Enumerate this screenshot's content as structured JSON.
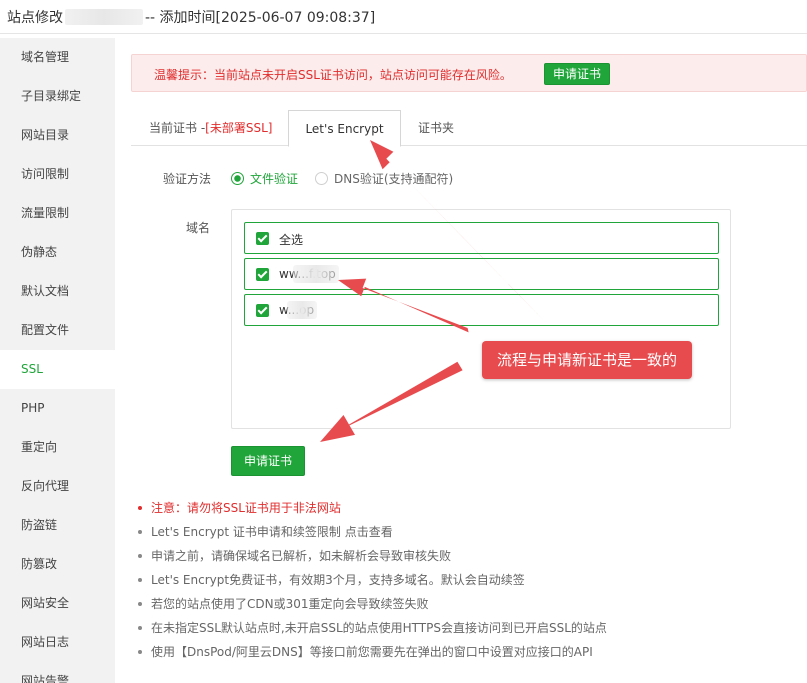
{
  "window": {
    "title_prefix": "站点修改",
    "title_suffix": "-- 添加时间[2025-06-07 09:08:37]"
  },
  "sidebar": {
    "items": [
      {
        "label": "域名管理"
      },
      {
        "label": "子目录绑定"
      },
      {
        "label": "网站目录"
      },
      {
        "label": "访问限制"
      },
      {
        "label": "流量限制"
      },
      {
        "label": "伪静态"
      },
      {
        "label": "默认文档"
      },
      {
        "label": "配置文件"
      },
      {
        "label": "SSL",
        "active": true
      },
      {
        "label": "PHP"
      },
      {
        "label": "重定向"
      },
      {
        "label": "反向代理"
      },
      {
        "label": "防盗链"
      },
      {
        "label": "防篡改"
      },
      {
        "label": "网站安全"
      },
      {
        "label": "网站日志"
      },
      {
        "label": "网站告警"
      }
    ]
  },
  "alert": {
    "text": "温馨提示：当前站点未开启SSL证书访问，站点访问可能存在风险。",
    "button": "申请证书"
  },
  "tabs": {
    "current_cert": "当前证书 -",
    "current_cert_status": "[未部署SSL]",
    "letsencrypt": "Let's Encrypt",
    "cert_folder": "证书夹"
  },
  "form": {
    "verify_label": "验证方法",
    "verify_options": {
      "file": "文件验证",
      "dns": "DNS验证(支持通配符)"
    },
    "selected_verify": "file",
    "domain_label": "域名",
    "domains": [
      {
        "label": "全选",
        "checked": true
      },
      {
        "label": "ww...f.top",
        "checked": true
      },
      {
        "label": "w...op",
        "checked": true
      }
    ],
    "apply_button": "申请证书"
  },
  "notes": [
    {
      "text": "注意：请勿将SSL证书用于非法网站",
      "warn": true
    },
    {
      "text": "Let's Encrypt 证书申请和续签限制 点击查看",
      "warn": false
    },
    {
      "text": "申请之前，请确保域名已解析，如未解析会导致审核失败",
      "warn": false
    },
    {
      "text": "Let's Encrypt免费证书，有效期3个月，支持多域名。默认会自动续签",
      "warn": false
    },
    {
      "text": "若您的站点使用了CDN或301重定向会导致续签失败",
      "warn": false
    },
    {
      "text": "在未指定SSL默认站点时,未开启SSL的站点使用HTTPS会直接访问到已开启SSL的站点",
      "warn": false
    },
    {
      "text": "使用【DnsPod/阿里云DNS】等接口前您需要先在弹出的窗口中设置对应接口的API",
      "warn": false
    }
  ],
  "annotation": {
    "callout_text": "流程与申请新证书是一致的"
  },
  "colors": {
    "brand_green": "#20a53a",
    "alert_red": "#e02d2d",
    "annotation_red": "#e84b4e"
  }
}
